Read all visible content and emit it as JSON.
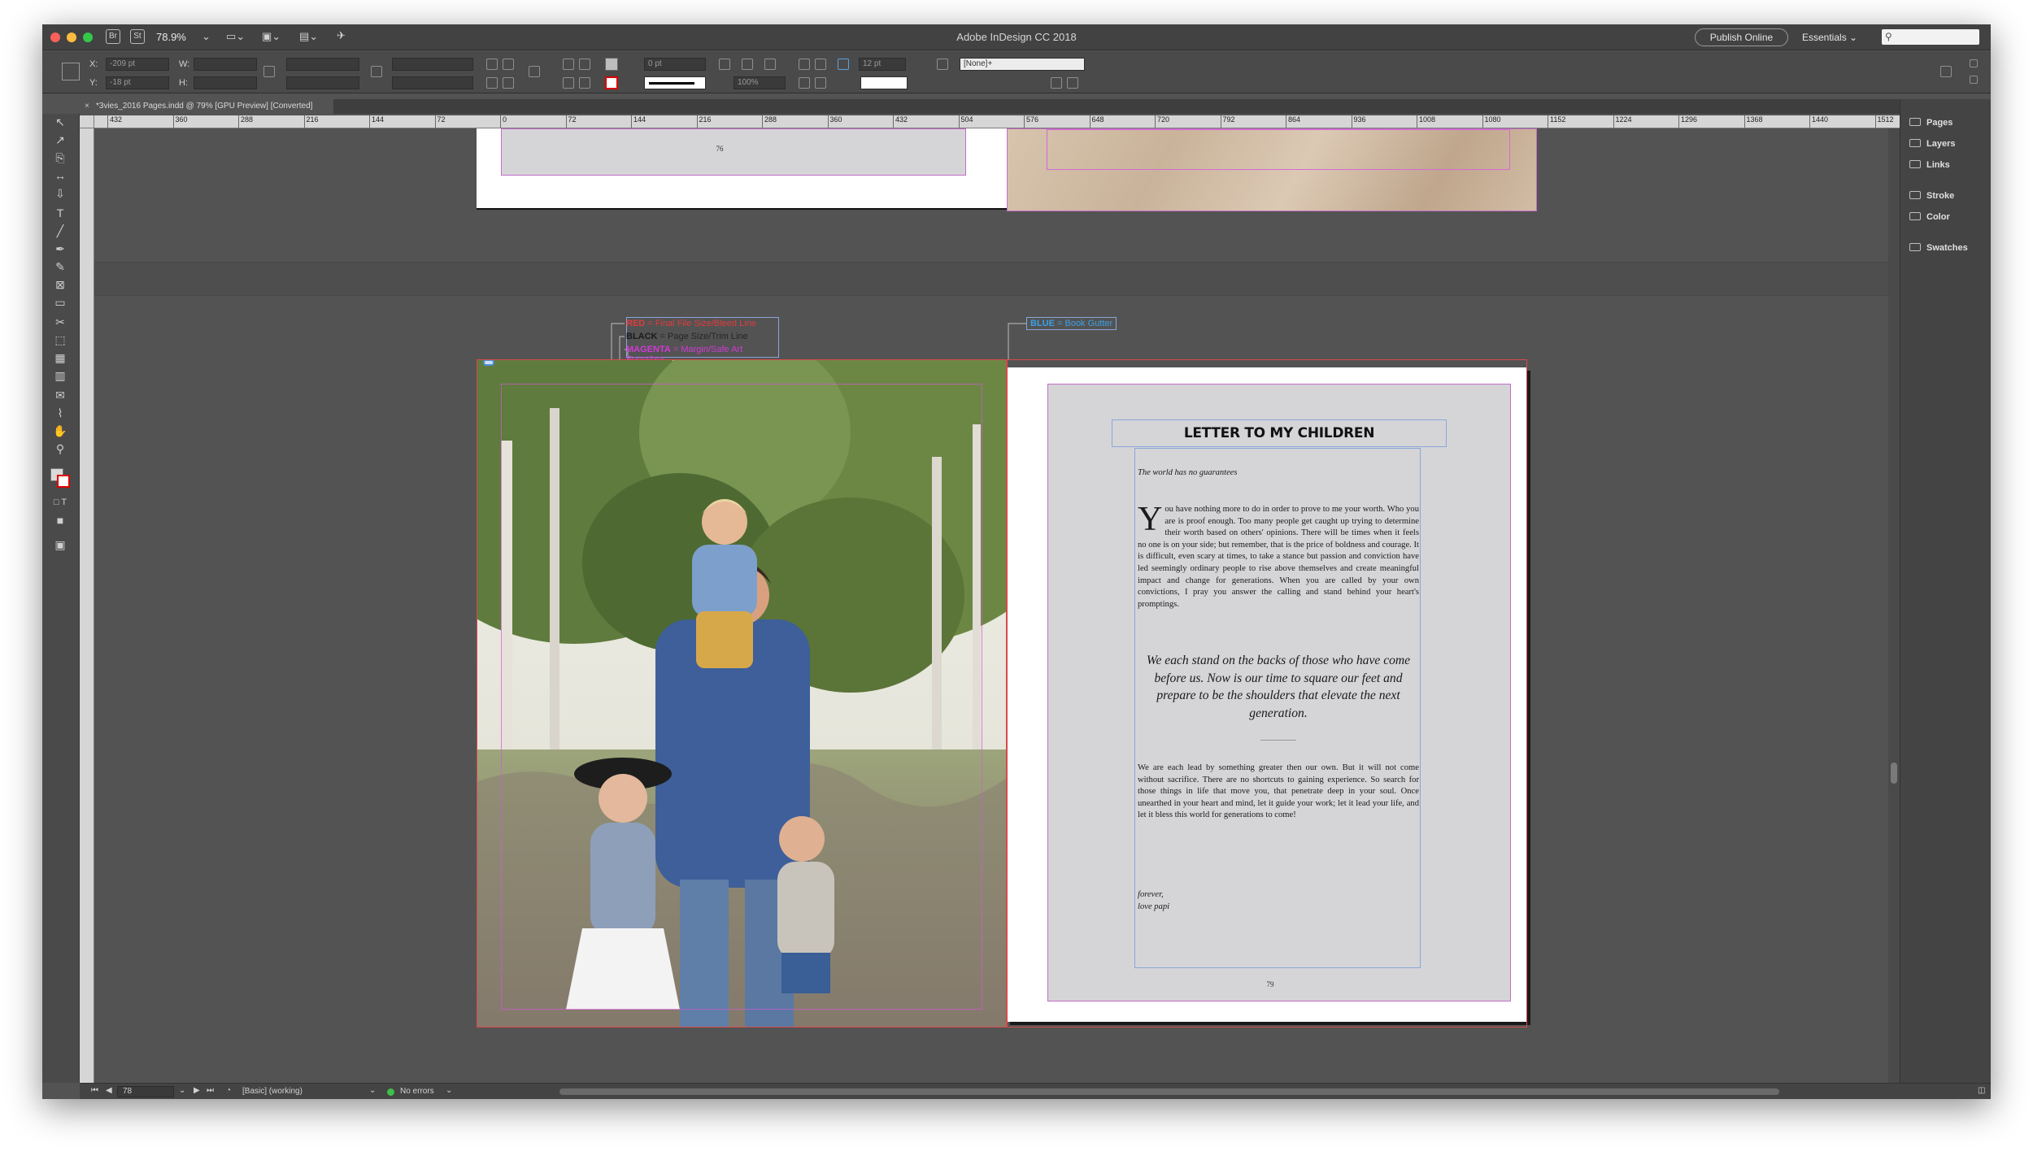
{
  "window": {
    "title": "Adobe InDesign CC 2018",
    "zoom": "78.9%",
    "app_badges": [
      "Br",
      "St"
    ],
    "publish_label": "Publish Online",
    "workspace_label": "Essentials",
    "search_icon": "search-icon"
  },
  "control_panel": {
    "x_label": "X:",
    "x_value": "-209 pt",
    "y_label": "Y:",
    "y_value": "-18 pt",
    "w_label": "W:",
    "h_label": "H:",
    "stroke_weight": "0 pt",
    "opacity": "100%",
    "gap_value": "12 pt",
    "object_style": "[None]+"
  },
  "document_tab": {
    "label": "*3vies_2016 Pages.indd @ 79% [GPU Preview] [Converted]"
  },
  "ruler": {
    "ticks": [
      "432",
      "360",
      "288",
      "216",
      "144",
      "72",
      "0",
      "72",
      "144",
      "216",
      "288",
      "360",
      "432",
      "504",
      "576",
      "648",
      "720",
      "792",
      "864",
      "936",
      "1008",
      "1080",
      "1152",
      "1224",
      "1296",
      "1368",
      "1440",
      "1512"
    ]
  },
  "panels": [
    {
      "label": "Pages",
      "icon": "pages-icon"
    },
    {
      "label": "Layers",
      "icon": "layers-icon"
    },
    {
      "label": "Links",
      "icon": "links-icon"
    },
    {
      "label": "Stroke",
      "icon": "stroke-icon"
    },
    {
      "label": "Color",
      "icon": "color-icon"
    },
    {
      "label": "Swatches",
      "icon": "swatches-icon"
    }
  ],
  "legend": {
    "red_key": "RED",
    "red_text": " = Final File Size/Bleed Line",
    "black_key": "BLACK",
    "black_text": " = Page Size/Trim Line",
    "magenta_key": "MAGENTA",
    "magenta_text": " = Margin/Safe Art Boundary",
    "blue_key": "BLUE",
    "blue_text": " = Book Gutter",
    "colors": {
      "red": "#e03c3c",
      "black": "#111111",
      "magenta": "#d23ad6",
      "blue": "#3aa0e6"
    }
  },
  "page_top": {
    "folio": "76"
  },
  "letter": {
    "title": "LETTER TO MY CHILDREN",
    "subtitle": "The world has no guarantees",
    "drop_cap": "Y",
    "body1": "ou have nothing more to do in order to prove to me your worth. Who you are is proof enough. Too many people get caught up trying to determine their worth based on others' opinions. There will be times when it feels no one is on your side; but remember, that is the price of boldness and courage. It is difficult, even scary at times, to take a stance but passion and conviction have led seemingly ordinary people to rise above themselves and create meaningful impact and change for generations. When you are called by your own convictions, I pray you answer the calling and stand behind your heart's promptings.",
    "pullquote": "We each stand on the backs of those who have come before us. Now is our time to square our feet and prepare to be the shoulders that elevate the next generation.",
    "body2": "We are each lead by something greater then our own. But it will not come without sacrifice. There are no shortcuts to gaining experience. So search for those things in life that move you, that penetrate deep in your soul. Once unearthed in your heart and mind, let it guide your work; let it lead your life, and let it bless this world for generations to come!",
    "signoff_1": "forever,",
    "signoff_2": "love papi",
    "folio": "79"
  },
  "status": {
    "page_number": "78",
    "preflight_profile": "[Basic] (working)",
    "errors": "No errors"
  }
}
